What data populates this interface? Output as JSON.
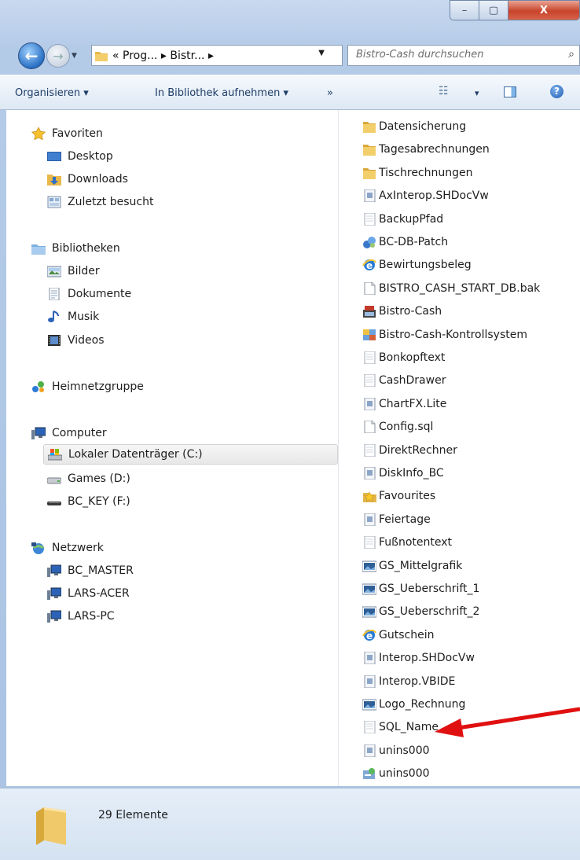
{
  "window": {
    "title_buttons": {
      "minimize": "–",
      "maximize": "▢",
      "close": "X"
    }
  },
  "address": {
    "crumbs": "« Prog... ▸ Bistr... ▸",
    "search_placeholder": "Bistro-Cash durchsuchen"
  },
  "toolbar": {
    "organize": "Organisieren ▾",
    "library": "In Bibliothek aufnehmen ▾",
    "more": "»",
    "view_drop": "▾"
  },
  "nav": {
    "favorites": {
      "label": "Favoriten",
      "items": [
        "Desktop",
        "Downloads",
        "Zuletzt besucht"
      ]
    },
    "libraries": {
      "label": "Bibliotheken",
      "items": [
        "Bilder",
        "Dokumente",
        "Musik",
        "Videos"
      ]
    },
    "homegroup": "Heimnetzgruppe",
    "computer": {
      "label": "Computer",
      "items": [
        "Lokaler Datenträger (C:)",
        "Games (D:)",
        "BC_KEY (F:)"
      ]
    },
    "network": {
      "label": "Netzwerk",
      "items": [
        "BC_MASTER",
        "LARS-ACER",
        "LARS-PC"
      ]
    }
  },
  "files": [
    {
      "name": "Datensicherung",
      "icon": "folder"
    },
    {
      "name": "Tagesabrechnungen",
      "icon": "folder"
    },
    {
      "name": "Tischrechnungen",
      "icon": "folder"
    },
    {
      "name": "AxInterop.SHDocVw",
      "icon": "dll"
    },
    {
      "name": "BackupPfad",
      "icon": "text"
    },
    {
      "name": "BC-DB-Patch",
      "icon": "app-blue"
    },
    {
      "name": "Bewirtungsbeleg",
      "icon": "ie"
    },
    {
      "name": "BISTRO_CASH_START_DB.bak",
      "icon": "blank"
    },
    {
      "name": "Bistro-Cash",
      "icon": "register"
    },
    {
      "name": "Bistro-Cash-Kontrollsystem",
      "icon": "app-color"
    },
    {
      "name": "Bonkopftext",
      "icon": "text"
    },
    {
      "name": "CashDrawer",
      "icon": "text"
    },
    {
      "name": "ChartFX.Lite",
      "icon": "dll"
    },
    {
      "name": "Config.sql",
      "icon": "blank"
    },
    {
      "name": "DirektRechner",
      "icon": "text"
    },
    {
      "name": "DiskInfo_BC",
      "icon": "dll"
    },
    {
      "name": "Favourites",
      "icon": "star"
    },
    {
      "name": "Feiertage",
      "icon": "dll"
    },
    {
      "name": "Fußnotentext",
      "icon": "text"
    },
    {
      "name": "GS_Mittelgrafik",
      "icon": "image"
    },
    {
      "name": "GS_Ueberschrift_1",
      "icon": "image"
    },
    {
      "name": "GS_Ueberschrift_2",
      "icon": "image"
    },
    {
      "name": "Gutschein",
      "icon": "ie"
    },
    {
      "name": "Interop.SHDocVw",
      "icon": "dll"
    },
    {
      "name": "Interop.VBIDE",
      "icon": "dll"
    },
    {
      "name": "Logo_Rechnung",
      "icon": "image"
    },
    {
      "name": "SQL_Name",
      "icon": "text"
    },
    {
      "name": "unins000",
      "icon": "dll"
    },
    {
      "name": "unins000",
      "icon": "installer"
    }
  ],
  "status": {
    "count": "29 Elemente"
  },
  "colors": {
    "arrow": "#e01010"
  }
}
